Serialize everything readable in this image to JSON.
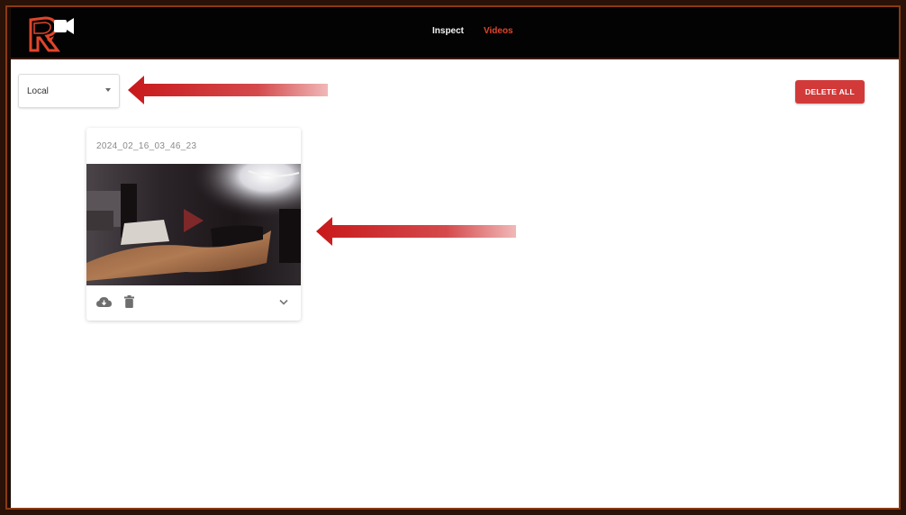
{
  "nav": {
    "items": [
      {
        "label": "Inspect",
        "active": false
      },
      {
        "label": "Videos",
        "active": true
      }
    ]
  },
  "source_select": {
    "value": "Local",
    "icon": "chevron-down-icon"
  },
  "toolbar": {
    "delete_all_label": "DELETE ALL"
  },
  "videos": [
    {
      "title": "2024_02_16_03_46_23",
      "actions": [
        "cloud-download-icon",
        "trash-icon"
      ],
      "expand_icon": "chevron-down-icon"
    }
  ],
  "colors": {
    "accent": "#e0452b",
    "delete_button": "#d23a3a",
    "annotation_arrow": "#c8181b",
    "topbar": "#030303"
  }
}
